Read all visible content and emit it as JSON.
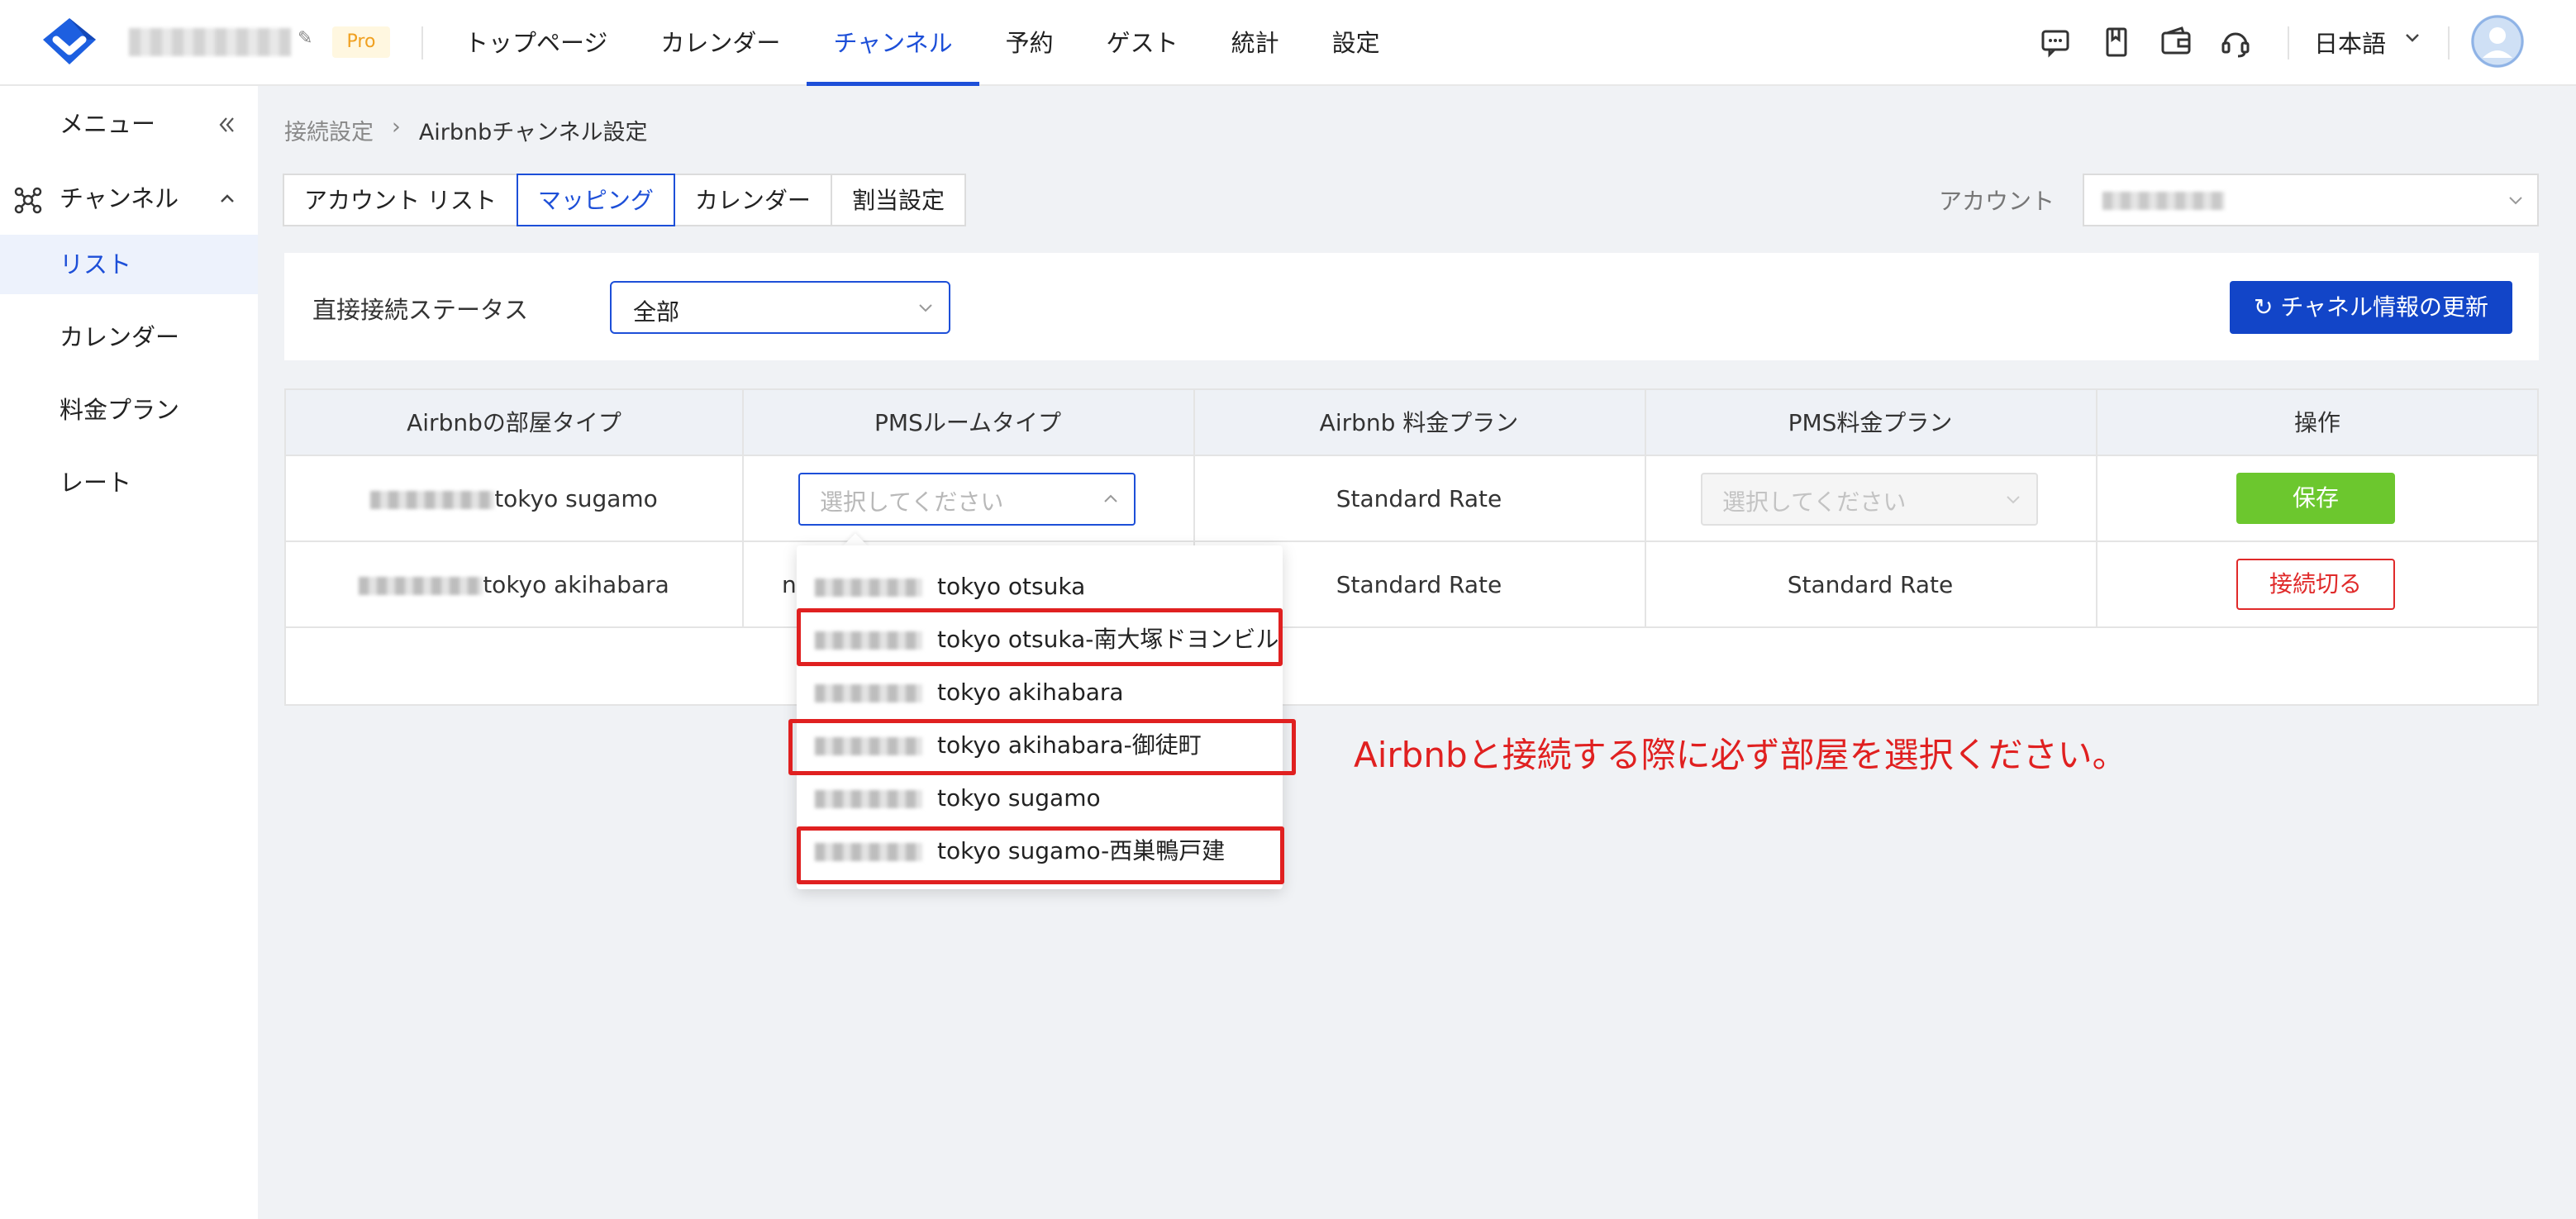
{
  "header": {
    "pro_badge": "Pro",
    "nav": [
      "トップページ",
      "カレンダー",
      "チャンネル",
      "予約",
      "ゲスト",
      "統計",
      "設定"
    ],
    "active_nav": "チャンネル",
    "language": "日本語"
  },
  "sidebar": {
    "menu_label": "メニュー",
    "channel_label": "チャンネル",
    "items": [
      "リスト",
      "カレンダー",
      "料金プラン",
      "レート"
    ]
  },
  "breadcrumb": [
    "接続設定",
    "Airbnbチャンネル設定"
  ],
  "tabs": [
    "アカウント リスト",
    "マッピング",
    "カレンダー",
    "割当設定"
  ],
  "account_label": "アカウント",
  "filter": {
    "label": "直接接続ステータス",
    "value": "全部",
    "refresh_button": "チャネル情報の更新"
  },
  "table": {
    "headers": [
      "Airbnbの部屋タイプ",
      "PMSルームタイプ",
      "Airbnb 料金プラン",
      "PMS料金プラン",
      "操作"
    ],
    "rows": [
      {
        "room": "tokyo sugamo",
        "pms_placeholder": "選択してください",
        "airbnb_plan": "Standard Rate",
        "pms_plan_placeholder": "選択してください",
        "action": "保存"
      },
      {
        "room": "tokyo akihabara",
        "pms_prefix": "n",
        "airbnb_plan": "Standard Rate",
        "pms_plan": "Standard Rate",
        "action": "接続切る"
      }
    ]
  },
  "dropdown_options": [
    "tokyo otsuka",
    "tokyo otsuka-南大塚ドヨンビル",
    "tokyo akihabara",
    "tokyo akihabara-御徒町",
    "tokyo sugamo",
    "tokyo sugamo-西巣鴨戸建"
  ],
  "annotation": "Airbnbと接続する際に必ず部屋を選択ください。",
  "colors": {
    "accent": "#1d4fd8",
    "save": "#6cc72e",
    "danger": "#e02a2a",
    "annotation": "#e02020"
  }
}
